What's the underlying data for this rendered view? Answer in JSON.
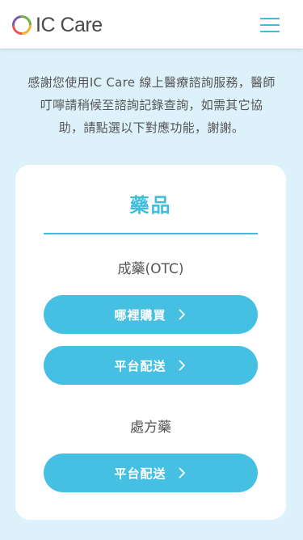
{
  "header": {
    "logo_text": "IC Care",
    "menu_icon": "hamburger-menu-icon",
    "accent_color": "#3dbfdb"
  },
  "intro": {
    "line1": "感謝您使用IC Care 線上醫療諮詢服務，醫師",
    "line2": "叮嚀請稍候至諮詢記錄查詢，如需其它協",
    "line3": "助，請點選以下對應功能，謝謝。"
  },
  "card": {
    "title": "藥品",
    "sections": [
      {
        "label": "成藥(OTC)",
        "buttons": [
          {
            "label": "哪裡購買",
            "icon": "chevron-right-icon"
          },
          {
            "label": "平台配送",
            "icon": "chevron-right-icon"
          }
        ]
      },
      {
        "label": "處方藥",
        "buttons": [
          {
            "label": "平台配送",
            "icon": "chevron-right-icon"
          }
        ]
      }
    ]
  }
}
